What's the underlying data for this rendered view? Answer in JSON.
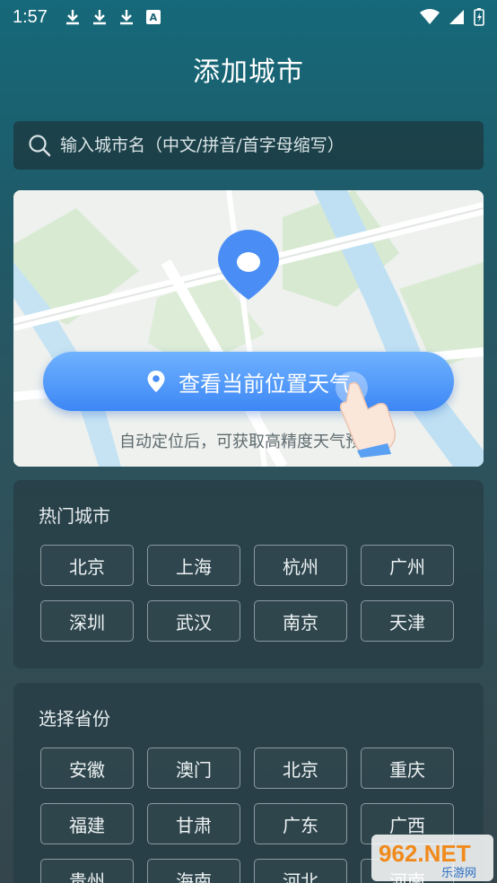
{
  "status_bar": {
    "time": "1:57"
  },
  "header": {
    "title": "添加城市"
  },
  "search": {
    "placeholder": "输入城市名（中文/拼音/首字母缩写）"
  },
  "location_card": {
    "button_label": "查看当前位置天气",
    "hint": "自动定位后，可获取高精度天气预报"
  },
  "hot_cities": {
    "title": "热门城市",
    "items": [
      "北京",
      "上海",
      "杭州",
      "广州",
      "深圳",
      "武汉",
      "南京",
      "天津"
    ]
  },
  "provinces": {
    "title": "选择省份",
    "items": [
      "安徽",
      "澳门",
      "北京",
      "重庆",
      "福建",
      "甘肃",
      "广东",
      "广西",
      "贵州",
      "海南",
      "河北",
      "河南"
    ]
  },
  "watermark": {
    "text": "962.NET",
    "subtext": "乐游网"
  },
  "colors": {
    "accent_blue": "#3d87f5",
    "panel_bg": "#283e46"
  }
}
